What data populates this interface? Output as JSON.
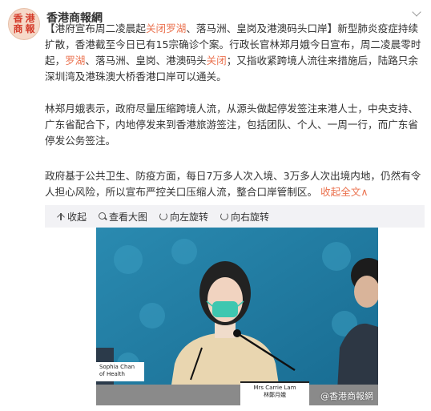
{
  "header": {
    "avatar_text": [
      "香",
      "港",
      "商",
      "報"
    ],
    "username": "香港商報網"
  },
  "post": {
    "p1": [
      {
        "t": "【港府宣布周二凌晨起"
      },
      {
        "t": "关闭罗湖",
        "hl": true
      },
      {
        "t": "、落马洲、皇岗及港澳码头口岸】新型肺炎疫症持续扩散，香港截至今日已有15宗确诊个案。行政长官林郑月娥今日宣布，周二凌晨零时起，"
      },
      {
        "t": "罗湖",
        "hl": true
      },
      {
        "t": "、落马洲、皇岗、港澳码头"
      },
      {
        "t": "关闭",
        "hl": true
      },
      {
        "t": "；又指收紧跨境人流往来措施后，陆路只余深圳湾及港珠澳大桥香港口岸可以通关。"
      }
    ],
    "p2": "林郑月娥表示，政府尽量压缩跨境人流，从源头做起停发签注来港人士，中央支持、广东省配合下，内地停发来到香港旅游签注，包括团队、个人、一周一行，而广东省停发公务签注。",
    "p3": "政府基于公共卫生、防疫方面，每日7万多人次入境、3万多人次出境内地，仍然有令人担心风险，所以宣布严控关口压缩人流，整合口岸管制区。",
    "collapse_link": "收起全文",
    "collapse_glyph": "∧"
  },
  "toolbar": {
    "collapse": "收起",
    "view_large": "查看大图",
    "rotate_left": "向左旋转",
    "rotate_right": "向右旋转"
  },
  "photo": {
    "watermark": "@香港商報網",
    "nameplate_main": [
      "Mrs Carrie Lam",
      "林鄭月娥"
    ],
    "nameplate_side": [
      "Sophia Chan",
      "of Health"
    ]
  },
  "colors": {
    "highlight": "#eb7350",
    "toolbar_bg": "#f2f2f5",
    "backdrop": "#1f7fa6"
  }
}
